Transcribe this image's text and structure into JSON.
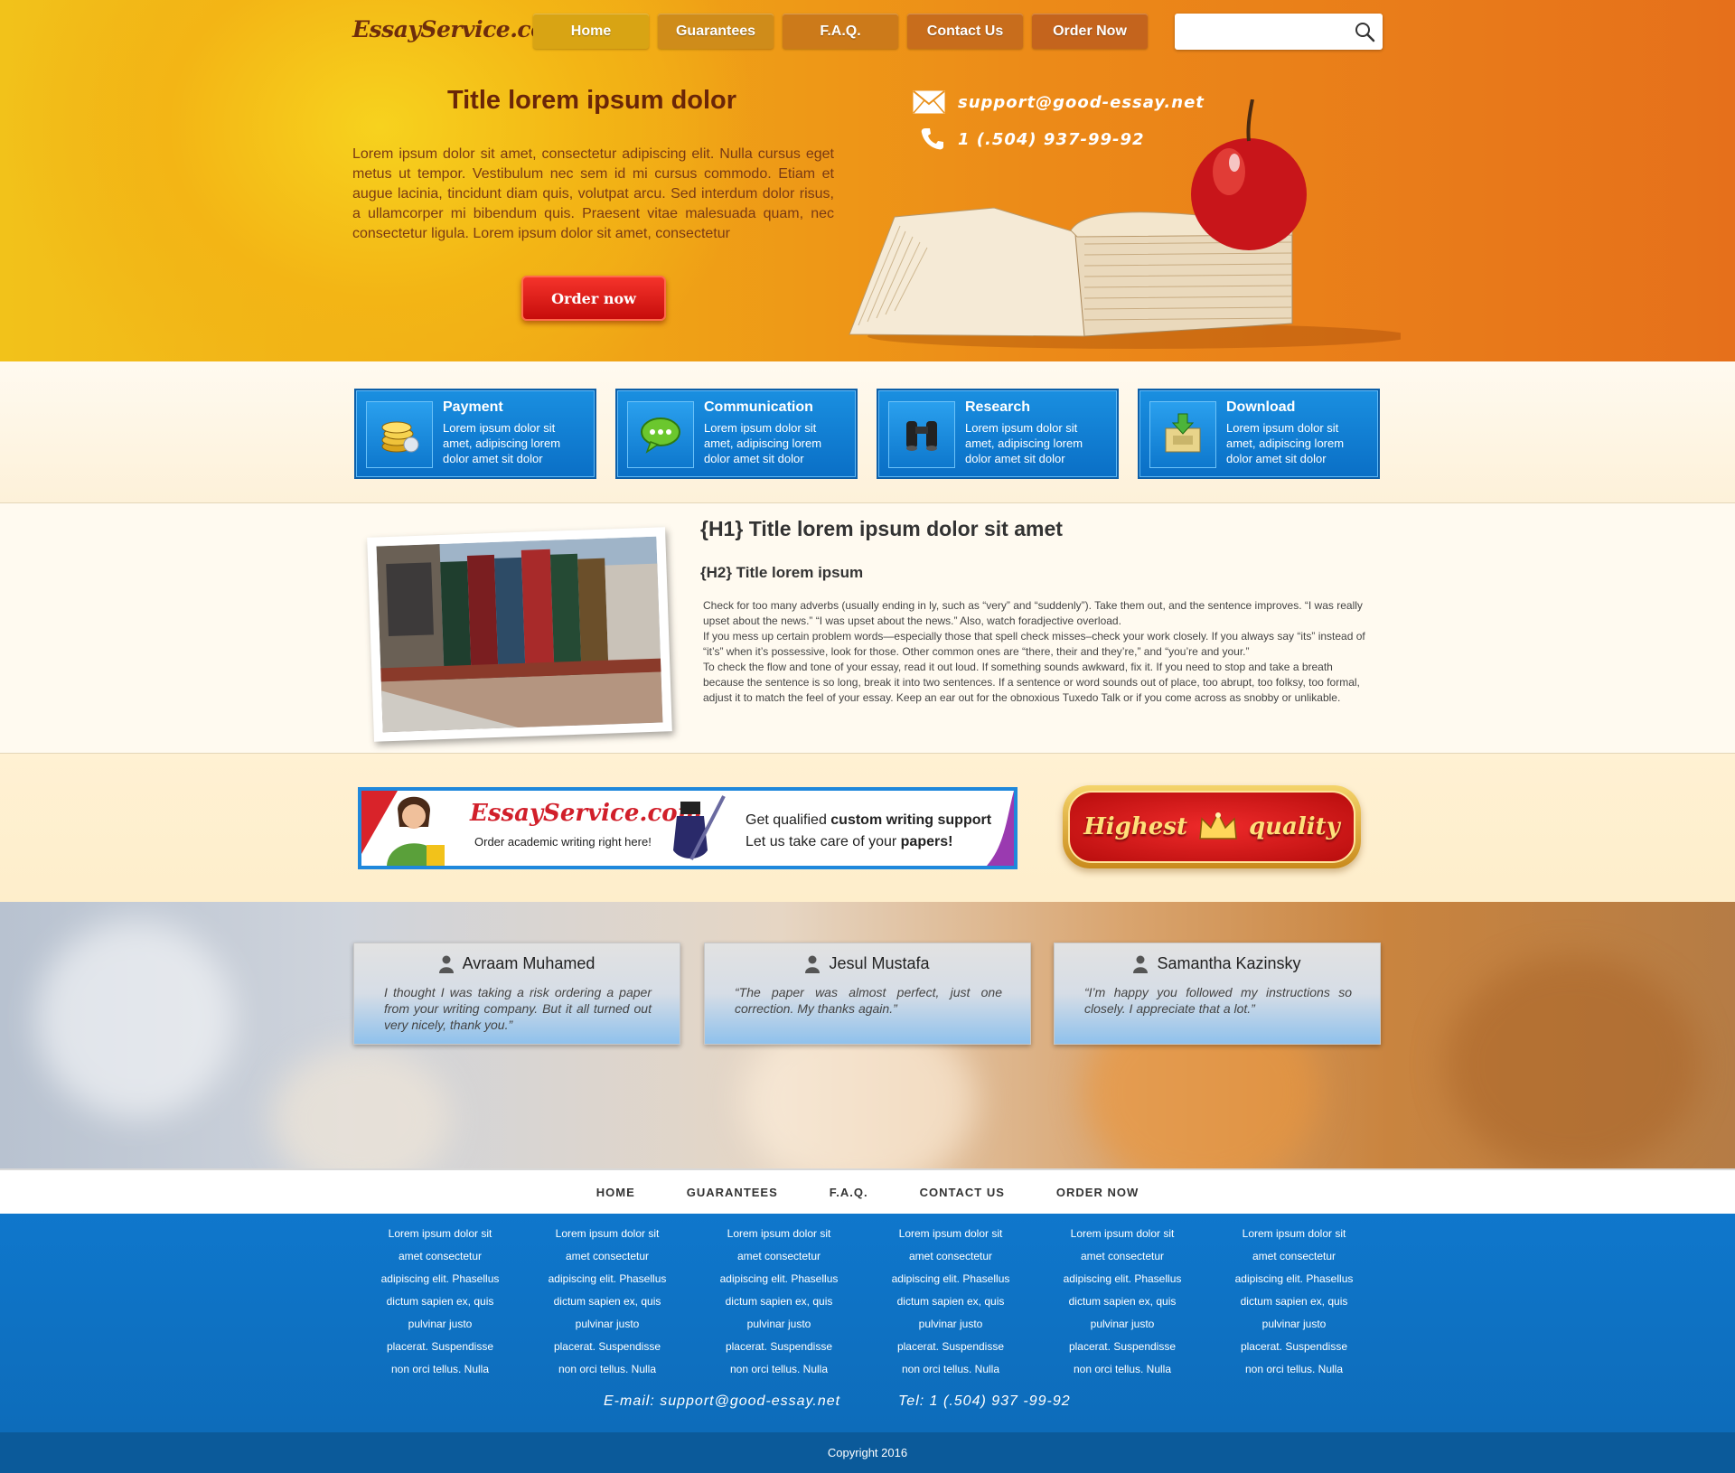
{
  "header": {
    "logo": "EssayService.com",
    "nav": [
      "Home",
      "Guarantees",
      "F.A.Q.",
      "Contact Us",
      "Order Now"
    ],
    "nav_colors": [
      "#d8a414",
      "#cf8c1a",
      "#cc7a1a",
      "#c86d1c",
      "#c4641d"
    ],
    "search_placeholder": "",
    "email": "support@good-essay.net",
    "phone": "1 (.504) 937-99-92"
  },
  "hero": {
    "title": "Title lorem ipsum dolor",
    "text": "Lorem ipsum dolor sit amet, consectetur adipiscing elit. Nulla cursus eget metus ut tempor. Vestibulum nec sem id mi cursus commodo. Etiam et augue lacinia, tincidunt diam quis, volutpat arcu. Sed interdum dolor risus, a ullamcorper mi bibendum quis. Praesent vitae malesuada quam, nec consectetur ligula. Lorem ipsum dolor sit amet, consectetur",
    "order_label": "Order now"
  },
  "features": [
    {
      "title": "Payment",
      "desc": "Lorem ipsum dolor sit amet, adipiscing lorem dolor  amet sit dolor",
      "icon": "coins-icon"
    },
    {
      "title": "Communication",
      "desc": "Lorem ipsum dolor sit amet, adipiscing lorem dolor  amet sit dolor",
      "icon": "chat-bubble-icon"
    },
    {
      "title": "Research",
      "desc": "Lorem ipsum dolor sit amet, adipiscing lorem dolor  amet sit dolor",
      "icon": "binoculars-icon"
    },
    {
      "title": "Download",
      "desc": "Lorem ipsum dolor sit amet, adipiscing lorem dolor  amet sit dolor",
      "icon": "download-box-icon"
    }
  ],
  "article": {
    "h1": "{H1} Title lorem ipsum dolor sit amet",
    "h2": "{H2} Title lorem ipsum",
    "paragraphs": [
      "Check for too many adverbs (usually ending in ly, such as “very” and “suddenly”). Take them out, and the sentence improves. “I was really upset about the news.” “I was upset about the news.” Also, watch foradjective overload.",
      "If you mess up certain problem words—especially those that spell check misses–check your work closely. If you always say “its” instead of “it’s” when it’s possessive, look for those.  Other common ones are “there, their and they’re,” and “you’re and your.”",
      "To check the flow and tone of your essay, read it out loud. If something sounds awkward, fix it. If you need to stop and take a breath because the sentence is so long, break it into two sentences. If a sentence or word sounds out of place, too abrupt, too folksy, too formal, adjust it to match the feel of your essay. Keep an ear out for the obnoxious Tuxedo Talk or if you come across as snobby or unlikable."
    ]
  },
  "banner": {
    "brand": "EssayService.com",
    "sub": "Order academic writing right here!",
    "line1_a": "Get qualified ",
    "line1_b": "custom writing support",
    "line2_a": "Let us take care of your ",
    "line2_b": "papers!",
    "quality_a": "Highest",
    "quality_b": "quality"
  },
  "testimonials": [
    {
      "name": "Avraam Muhamed",
      "quote": "I thought I was taking a risk ordering a paper from your writing company. But it all turned out very nicely, thank you.”"
    },
    {
      "name": "Jesul Mustafa",
      "quote": "“The paper was almost perfect, just one correction. My thanks again.”"
    },
    {
      "name": "Samantha Kazinsky",
      "quote": "“I’m happy you followed my instructions so closely. I appreciate that a lot.”"
    }
  ],
  "footer": {
    "nav": [
      "HOME",
      "GUARANTEES",
      "F.A.Q.",
      "CONTACT US",
      "ORDER NOW"
    ],
    "column_lines": [
      "Lorem ipsum dolor sit",
      "amet consectetur",
      "adipiscing elit. Phasellus",
      "dictum sapien ex, quis",
      "pulvinar justo",
      "placerat. Suspendisse",
      "non orci tellus. Nulla"
    ],
    "email": "E-mail: support@good-essay.net",
    "tel": "Tel: 1 (.504) 937 -99-92",
    "copyright": "Copyright 2016"
  }
}
